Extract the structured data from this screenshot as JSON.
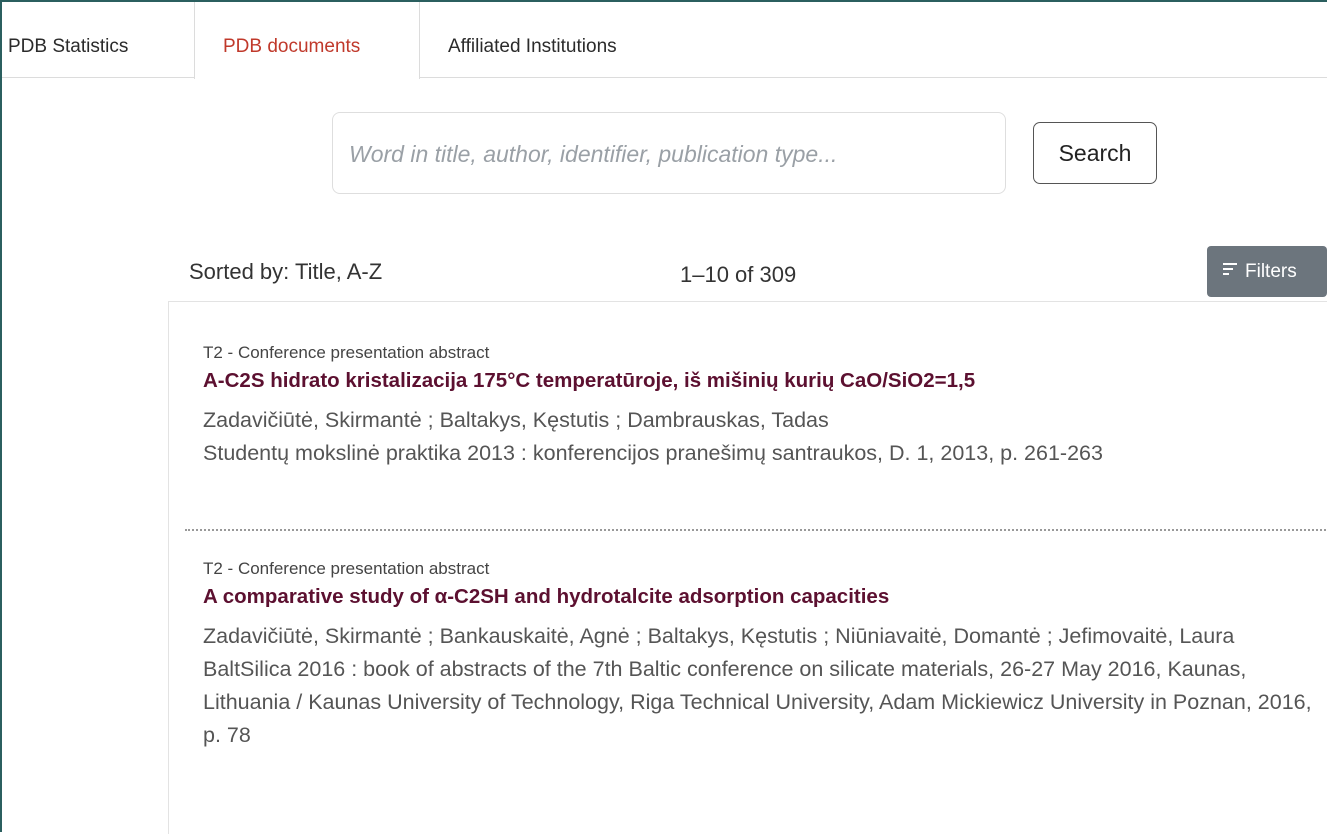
{
  "tabs": [
    {
      "label": "PDB Statistics",
      "active": false
    },
    {
      "label": "PDB documents",
      "active": true
    },
    {
      "label": "Affiliated Institutions",
      "active": false
    }
  ],
  "search": {
    "placeholder": "Word in title, author, identifier, publication type...",
    "value": "",
    "button_label": "Search"
  },
  "results_header": {
    "sorted_by": "Sorted by: Title, A-Z",
    "count": "1–10 of 309",
    "filters_label": "Filters"
  },
  "results": [
    {
      "type": "T2 - Conference presentation abstract",
      "title": "A-C2S hidrato kristalizacija 175°C temperatūroje, iš mišinių kurių CaO/SiO2=1,5",
      "authors": "Zadavičiūtė, Skirmantė ; Baltakys, Kęstutis ; Dambrauskas, Tadas",
      "source": "Studentų mokslinė praktika 2013 : konferencijos pranešimų santraukos, D. 1, 2013, p. 261-263"
    },
    {
      "type": "T2 - Conference presentation abstract",
      "title": "A comparative study of α-C2SH and hydrotalcite adsorption capacities",
      "authors": "Zadavičiūtė, Skirmantė ; Bankauskaitė, Agnė ; Baltakys, Kęstutis ; Niūniavaitė, Domantė ; Jefimovaitė, Laura",
      "source": "BaltSilica 2016 : book of abstracts of the 7th Baltic conference on silicate materials, 26-27 May 2016, Kaunas, Lithuania / Kaunas University of Technology, Riga Technical University, Adam Mickiewicz University in Poznan, 2016, p. 78"
    }
  ],
  "colors": {
    "active_tab": "#c0392b",
    "title": "#5c1030",
    "filters_bg": "#6c757d",
    "frame": "#2b5f5f"
  }
}
